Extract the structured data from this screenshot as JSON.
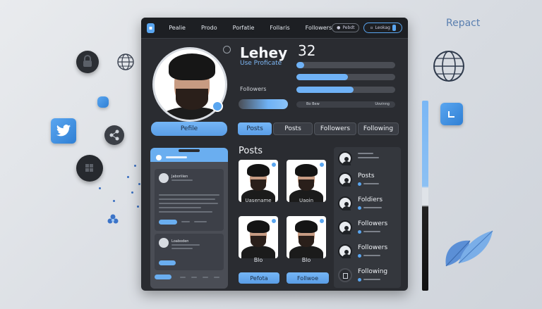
{
  "brand": {
    "right_text": "Repact"
  },
  "nav": {
    "items": [
      "Pealie",
      "Prodo",
      "Porfatie",
      "Follaris",
      "Followers"
    ],
    "pill1": "Pebdt",
    "pill2": "Leokag"
  },
  "profile": {
    "name": "Lehey",
    "age": "32",
    "subtitle": "Use Proficate",
    "followers_label": "Followers",
    "profile_button": "Pefile",
    "bar_labels": [
      "Bo Bew",
      "Uovinng"
    ]
  },
  "tabs": [
    "Posts",
    "Posts",
    "Followers",
    "Following"
  ],
  "posts": {
    "title": "Posts",
    "captions": [
      "Uasename",
      "Uaoin",
      "Blo",
      "Blo"
    ],
    "buttons": [
      "Pefota",
      "Follwoe"
    ]
  },
  "phone": {
    "card1_title": "Jaboriiien",
    "card2_title": "Loaboden"
  },
  "side_list": {
    "items": [
      "Posts",
      "Foldiers",
      "Followers",
      "Followers",
      "Following"
    ]
  },
  "colors": {
    "accent": "#6fb2f6",
    "panel": "#2a2c31",
    "topbar": "#1d1f23"
  }
}
